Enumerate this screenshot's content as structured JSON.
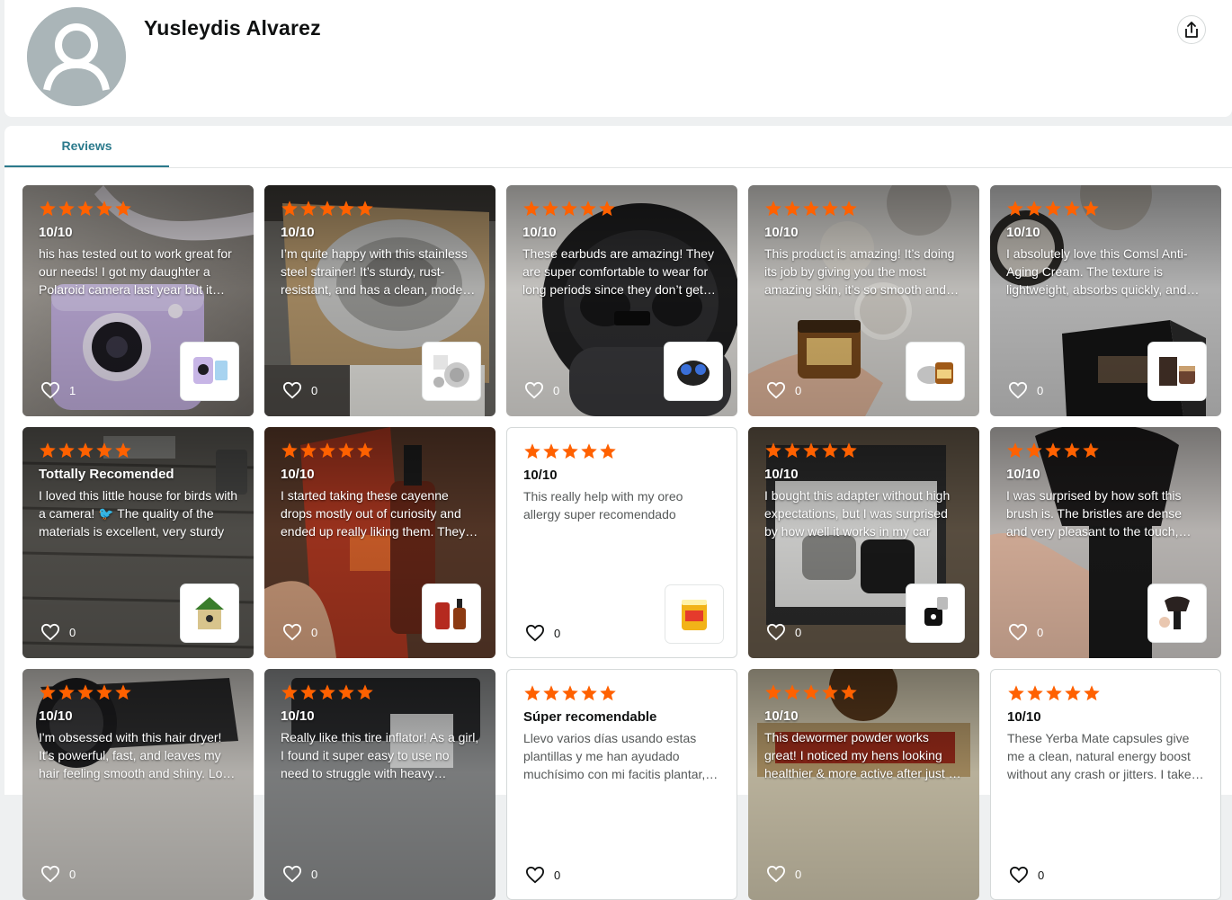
{
  "profile": {
    "name": "Yusleydis Alvarez"
  },
  "tabs": [
    {
      "label": "Reviews"
    }
  ],
  "colors": {
    "star": "#ff6100",
    "tab_accent": "#2b7a8c"
  },
  "reviews": [
    {
      "title": "10/10",
      "body": "his has tested out to work great for our needs! I got my daughter a Polaroid camera last year but it stopped working",
      "likes": "1",
      "photo": "purple-instant-camera",
      "thumb": "camera-product"
    },
    {
      "title": "10/10",
      "body": "I’m quite happy with this stainless steel strainer! It’s sturdy, rust-resistant, and has a clean, modern look",
      "likes": "0",
      "photo": "sink-strainer",
      "thumb": "strainer-product"
    },
    {
      "title": "10/10",
      "body": "These earbuds are amazing! They are super comfortable to wear for long periods since they don’t get heavy",
      "likes": "0",
      "photo": "earbuds-case",
      "thumb": "earbuds-product"
    },
    {
      "title": "10/10",
      "body": "This product is amazing! It’s doing its job by giving you the most amazing skin, it’s so smooth and soft",
      "likes": "0",
      "photo": "cream-jar-hand",
      "thumb": "cream-product"
    },
    {
      "title": "10/10",
      "body": "I absolutely love this Comsl Anti-Aging Cream. The texture is lightweight, absorbs quickly, and leaves skin soft",
      "likes": "0",
      "photo": "anti-aging-cream-box",
      "thumb": "cream-box-product"
    },
    {
      "title": "Tottally Recomended",
      "body": "I loved this little house for birds with a camera! 🐦 The quality of the materials is excellent, very sturdy",
      "likes": "0",
      "photo": "bird-house-wood",
      "thumb": "birdhouse-product"
    },
    {
      "title": "10/10",
      "body": "I started taking these cayenne drops mostly out of curiosity and ended up really liking them. They are potent",
      "likes": "0",
      "photo": "cayenne-drops-box",
      "thumb": "drops-product"
    },
    {
      "title": "10/10",
      "body": "This really help with my oreo allergy super recomendado",
      "likes": "0",
      "photo": "",
      "thumb": "supplement-product"
    },
    {
      "title": "10/10",
      "body": "I bought this adapter without high expectations, but I was surprised by how well it works in my car",
      "likes": "0",
      "photo": "wireless-adapter",
      "thumb": "adapter-product"
    },
    {
      "title": "10/10",
      "body": "I was surprised by how soft this brush is. The bristles are dense and very pleasant to the touch, great blending",
      "likes": "0",
      "photo": "makeup-brush",
      "thumb": "brush-product"
    },
    {
      "title": "10/10",
      "body": "I'm obsessed with this hair dryer! It's powerful, fast, and leaves my hair feeling smooth and shiny. Love it",
      "likes": "0",
      "photo": "hair-dryer",
      "thumb": ""
    },
    {
      "title": "10/10",
      "body": "Really like this tire inflator! As a girl, I found it super easy to use no need to struggle with heavy equipment",
      "likes": "0",
      "photo": "tire-inflator",
      "thumb": ""
    },
    {
      "title": "Súper recomendable",
      "body": "Llevo varios días usando estas plantillas y me han ayudado muchísimo con mi facitis plantar, las recomiendo",
      "likes": "0",
      "photo": "",
      "thumb": ""
    },
    {
      "title": "10/10",
      "body": "This dewormer powder works great! I noticed my hens looking healthier & more active after just a few days",
      "likes": "0",
      "photo": "dewormer-bag",
      "thumb": ""
    },
    {
      "title": "10/10",
      "body": "These Yerba Mate capsules give me a clean, natural energy boost without any crash or jitters. I take them daily",
      "likes": "0",
      "photo": "",
      "thumb": ""
    }
  ]
}
